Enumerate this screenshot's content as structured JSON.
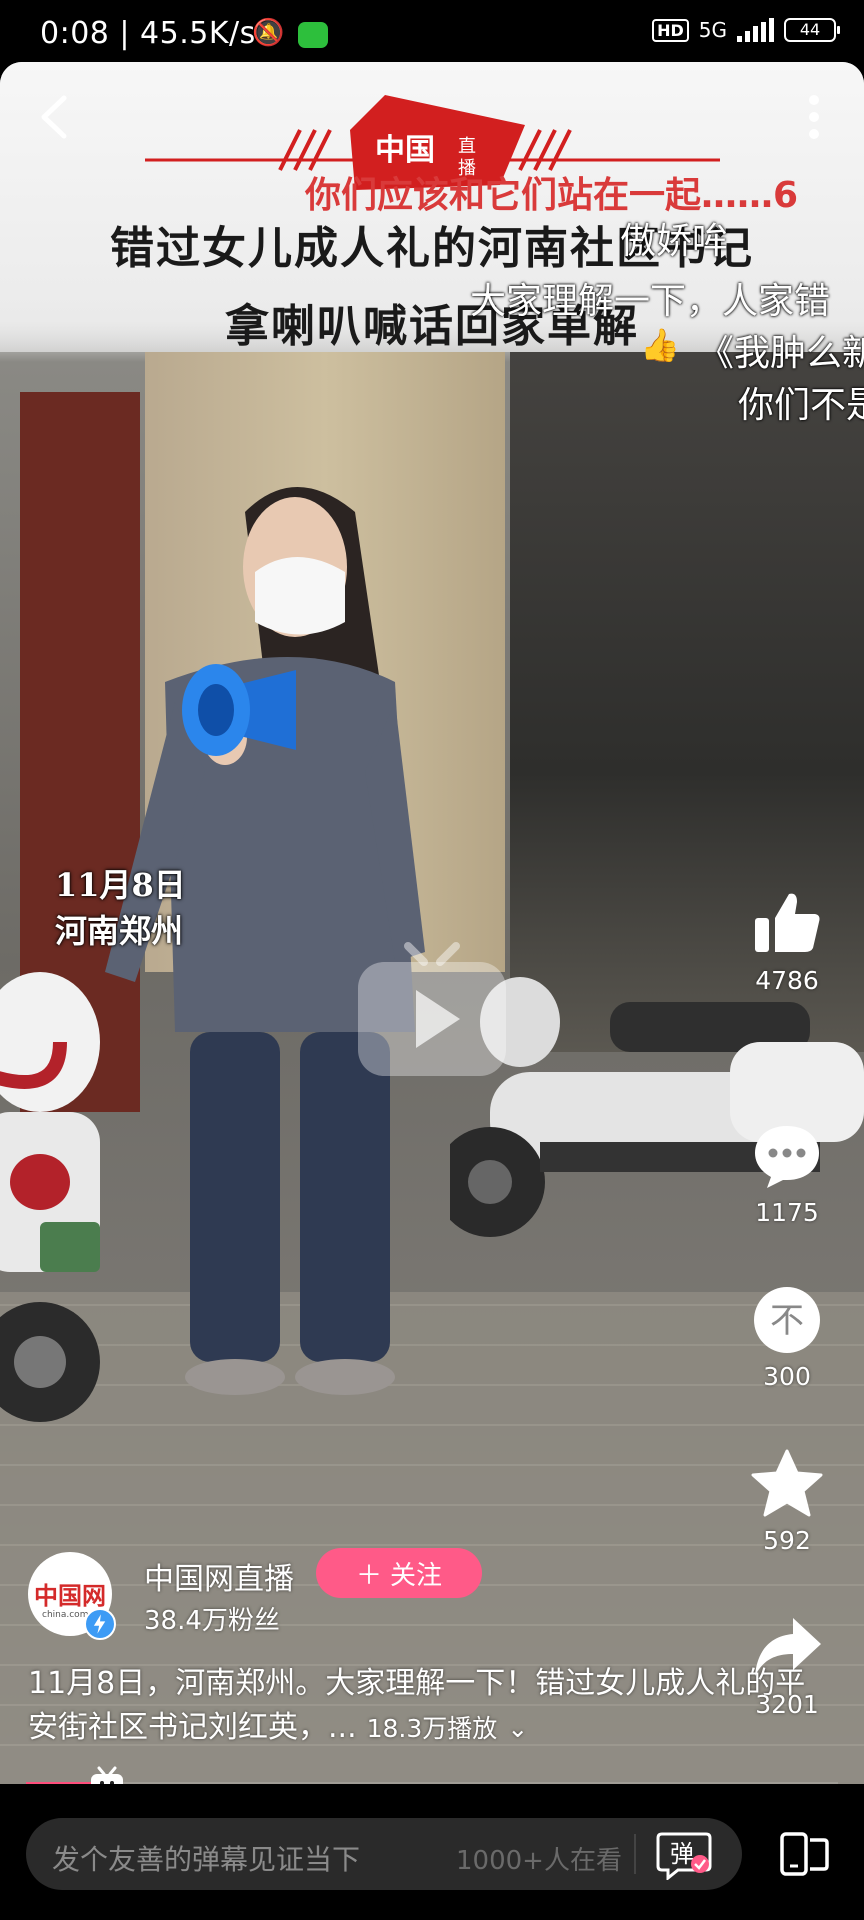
{
  "status_bar": {
    "time_speed": "0:08 | 45.5K/s",
    "hd": "HD",
    "network": "5G",
    "battery": "44"
  },
  "video": {
    "overlay_headline_1": "错过女儿成人礼的河南社区书记",
    "overlay_headline_2": "拿喇叭喊话回家单解",
    "date_location_1": "11月8日",
    "date_location_2": "河南郑州",
    "danmaku": [
      "你们应该和它们站在一起……6",
      "傲娇哞",
      "大家理解一下，人家错",
      "《我肿么新",
      "你们不是"
    ]
  },
  "actions": {
    "like_count": "4786",
    "comment_count": "1175",
    "coin_count": "300",
    "coin_glyph": "不",
    "favorite_count": "592",
    "share_count": "3201"
  },
  "author": {
    "name": "中国网直播",
    "fans": "38.4万粉丝",
    "follow_label": "关注",
    "avatar_logo": "中国网",
    "avatar_sub": "china.com"
  },
  "description": {
    "text": "11月8日，河南郑州。大家理解一下！错过女儿成人礼的平安街社区书记刘红英，...",
    "views": "18.3万播放"
  },
  "progress": {
    "fraction": 0.09
  },
  "bottom": {
    "danmaku_placeholder": "发个友善的弹幕见证当下",
    "watching": "1000+人在看",
    "danmaku_toggle_label": "弹"
  },
  "colors": {
    "accent_pink": "#ff5a88",
    "progress": "#ff4d7b",
    "wechat_green": "#2dbf3c",
    "danmaku_red": "#d93a3a"
  }
}
